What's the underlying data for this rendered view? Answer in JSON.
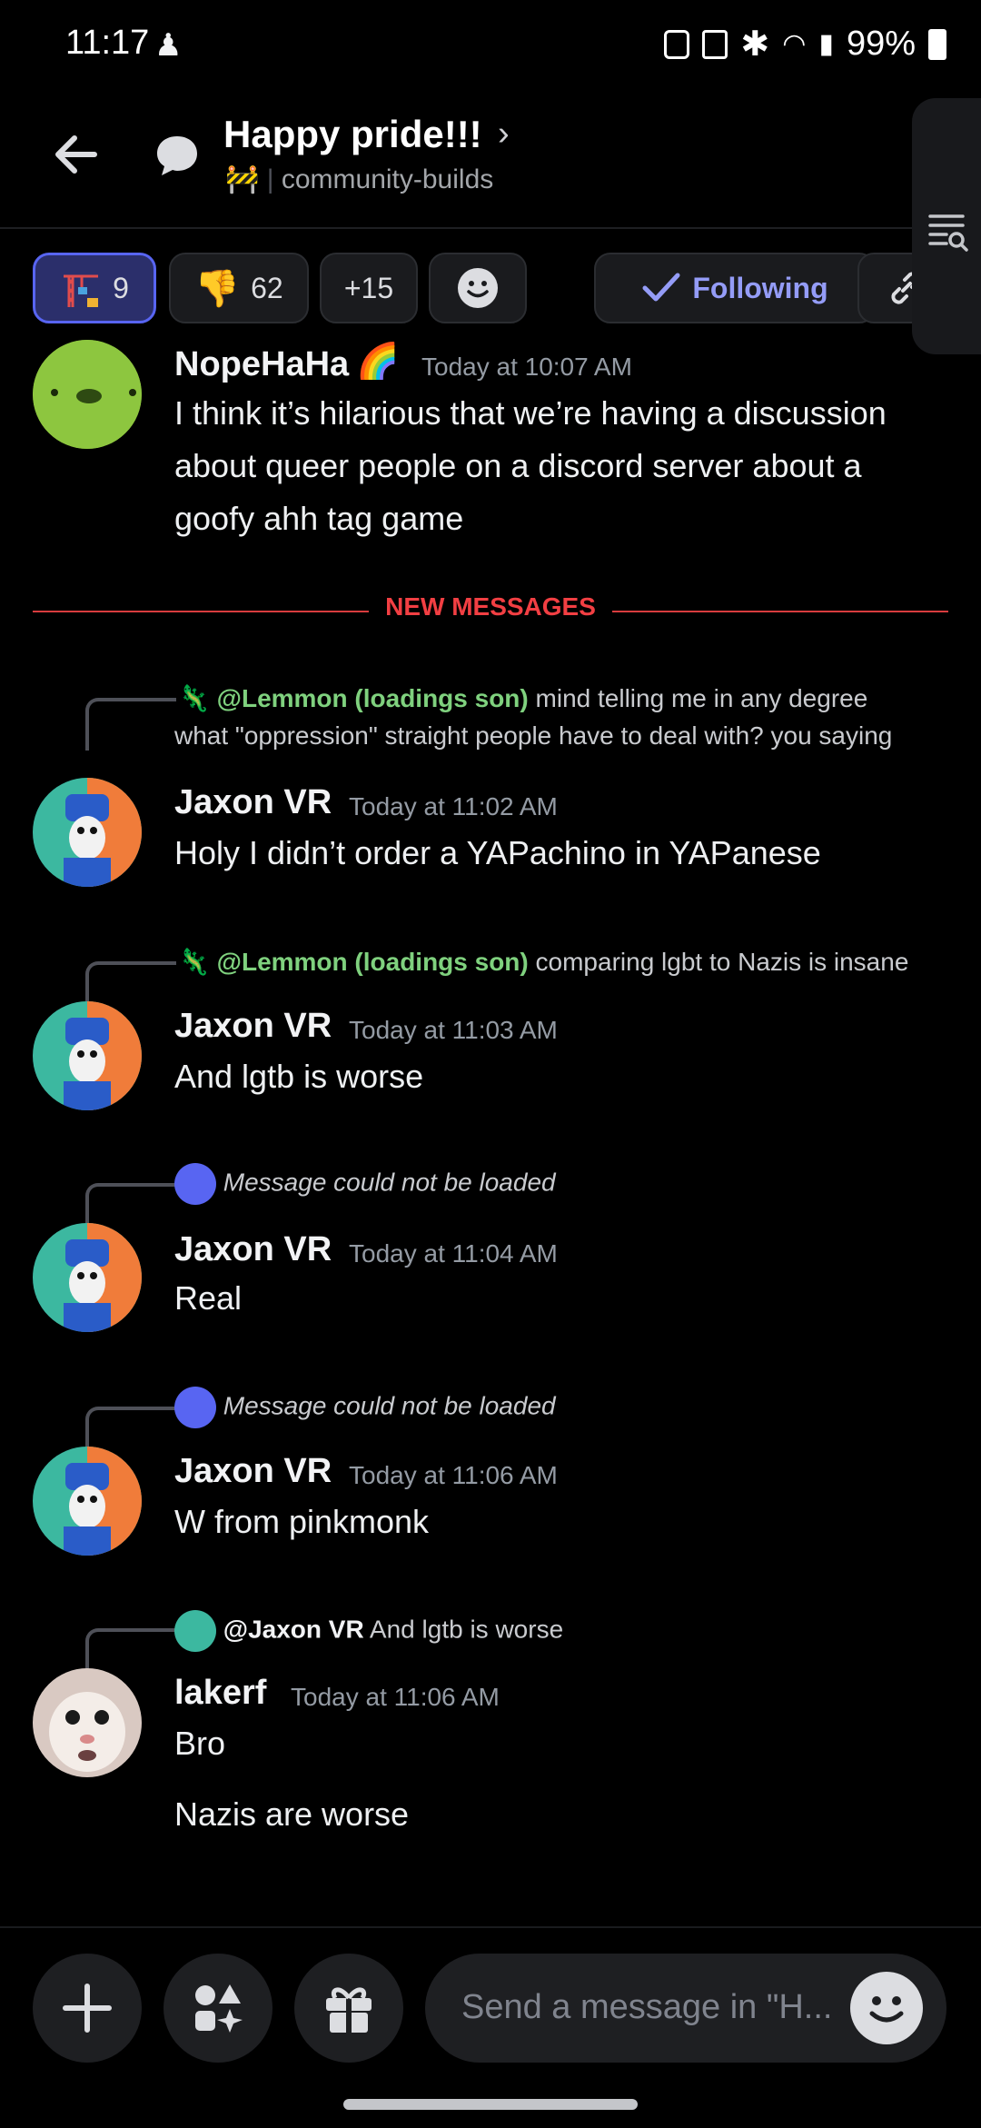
{
  "status_bar": {
    "time": "11:17",
    "battery": "99%"
  },
  "header": {
    "title": "Happy pride!!!",
    "channel_emoji": "🚧",
    "channel": "community-builds"
  },
  "reactions": [
    {
      "icon": "crane-emoji",
      "count": "9",
      "active": true
    },
    {
      "icon": "thumbs-down-emoji",
      "emoji": "👎",
      "count": "62",
      "active": false
    },
    {
      "label": "+15"
    },
    {
      "icon": "add-reaction-icon"
    }
  ],
  "follow_label": "Following",
  "divider_label": "NEW MESSAGES",
  "messages": [
    {
      "author": "NopeHaHa",
      "badge": "🌈",
      "time": "Today at 10:07 AM",
      "lines": [
        "I think it’s hilarious that we’re having a discussion",
        "about queer people on a discord server about a",
        "goofy ahh tag game"
      ]
    },
    {
      "reply_mention": "@Lemmon (loadings son)",
      "reply_text_1": "mind telling me in any degree",
      "reply_text_2": "what \"oppression\" straight people have to deal with? you saying",
      "author": "Jaxon VR",
      "time": "Today at 11:02 AM",
      "text": "Holy I didn’t order a YAPachino in YAPanese"
    },
    {
      "reply_mention": "@Lemmon (loadings son)",
      "reply_text": "comparing lgbt to Nazis is insane",
      "author": "Jaxon VR",
      "time": "Today at 11:03 AM",
      "text": "And lgtb is worse"
    },
    {
      "reply_text": "Message could not be loaded",
      "author": "Jaxon VR",
      "time": "Today at 11:04 AM",
      "text": "Real"
    },
    {
      "reply_text": "Message could not be loaded",
      "author": "Jaxon VR",
      "time": "Today at 11:06 AM",
      "text": "W from pinkmonk"
    },
    {
      "reply_mention": "@Jaxon VR",
      "reply_text": "And lgtb is worse",
      "author": "lakerf",
      "time": "Today at 11:06 AM",
      "text": "Bro",
      "text2": "Nazis are worse"
    }
  ],
  "composer": {
    "placeholder": "Send a message in \"H..."
  },
  "colors": {
    "accent": "#5865f2",
    "new_messages": "#f23f43",
    "mention": "#7fd17e"
  }
}
